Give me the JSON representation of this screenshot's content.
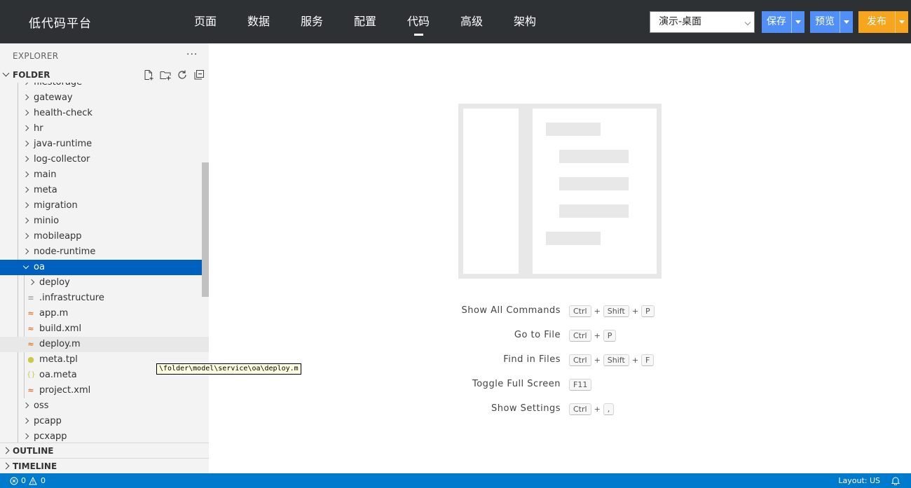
{
  "header": {
    "brand": "低代码平台",
    "nav": [
      {
        "label": "页面"
      },
      {
        "label": "数据"
      },
      {
        "label": "服务"
      },
      {
        "label": "配置"
      },
      {
        "label": "代码",
        "active": true
      },
      {
        "label": "高级"
      },
      {
        "label": "架构"
      }
    ],
    "env_select": "演示-桌面",
    "save_label": "保存",
    "preview_label": "预览",
    "publish_label": "发布"
  },
  "sidebar": {
    "explorer_title": "EXPLORER",
    "more_label": "···",
    "folder_label": "FOLDER",
    "outline_label": "OUTLINE",
    "timeline_label": "TIMELINE",
    "tree": [
      {
        "label": "filestorage",
        "type": "folder",
        "depth": 1
      },
      {
        "label": "gateway",
        "type": "folder",
        "depth": 1
      },
      {
        "label": "health-check",
        "type": "folder",
        "depth": 1
      },
      {
        "label": "hr",
        "type": "folder",
        "depth": 1
      },
      {
        "label": "java-runtime",
        "type": "folder",
        "depth": 1
      },
      {
        "label": "log-collector",
        "type": "folder",
        "depth": 1
      },
      {
        "label": "main",
        "type": "folder",
        "depth": 1
      },
      {
        "label": "meta",
        "type": "folder",
        "depth": 1
      },
      {
        "label": "migration",
        "type": "folder",
        "depth": 1
      },
      {
        "label": "minio",
        "type": "folder",
        "depth": 1
      },
      {
        "label": "mobileapp",
        "type": "folder",
        "depth": 1
      },
      {
        "label": "node-runtime",
        "type": "folder",
        "depth": 1
      },
      {
        "label": "oa",
        "type": "folder-open",
        "depth": 1,
        "selected": true
      },
      {
        "label": "deploy",
        "type": "folder",
        "depth": 2
      },
      {
        "label": ".infrastructure",
        "type": "file-lines",
        "depth": 2
      },
      {
        "label": "app.m",
        "type": "rss-file",
        "depth": 2
      },
      {
        "label": "build.xml",
        "type": "rss-file",
        "depth": 2
      },
      {
        "label": "deploy.m",
        "type": "rss-file",
        "depth": 2,
        "hover": true
      },
      {
        "label": "meta.tpl",
        "type": "bulb-file",
        "depth": 2
      },
      {
        "label": "oa.meta",
        "type": "json-file",
        "depth": 2
      },
      {
        "label": "project.xml",
        "type": "rss-file",
        "depth": 2
      },
      {
        "label": "oss",
        "type": "folder",
        "depth": 1
      },
      {
        "label": "pcapp",
        "type": "folder",
        "depth": 1
      },
      {
        "label": "pcxapp",
        "type": "folder",
        "depth": 1
      }
    ],
    "tooltip": "\\folder\\model\\service\\oa\\deploy.m"
  },
  "editor": {
    "shortcuts": [
      {
        "label": "Show All Commands",
        "keys": [
          "Ctrl",
          "Shift",
          "P"
        ]
      },
      {
        "label": "Go to File",
        "keys": [
          "Ctrl",
          "P"
        ]
      },
      {
        "label": "Find in Files",
        "keys": [
          "Ctrl",
          "Shift",
          "F"
        ]
      },
      {
        "label": "Toggle Full Screen",
        "keys": [
          "F11"
        ]
      },
      {
        "label": "Show Settings",
        "keys": [
          "Ctrl",
          ","
        ]
      }
    ]
  },
  "statusbar": {
    "errors": "0",
    "warnings": "0",
    "layout": "Layout: US"
  },
  "colors": {
    "topbar": "#2d3134",
    "selection": "#0060c0",
    "statusbar": "#007acc",
    "save_preview": "#4f8ff7",
    "publish": "#f7a51c"
  }
}
